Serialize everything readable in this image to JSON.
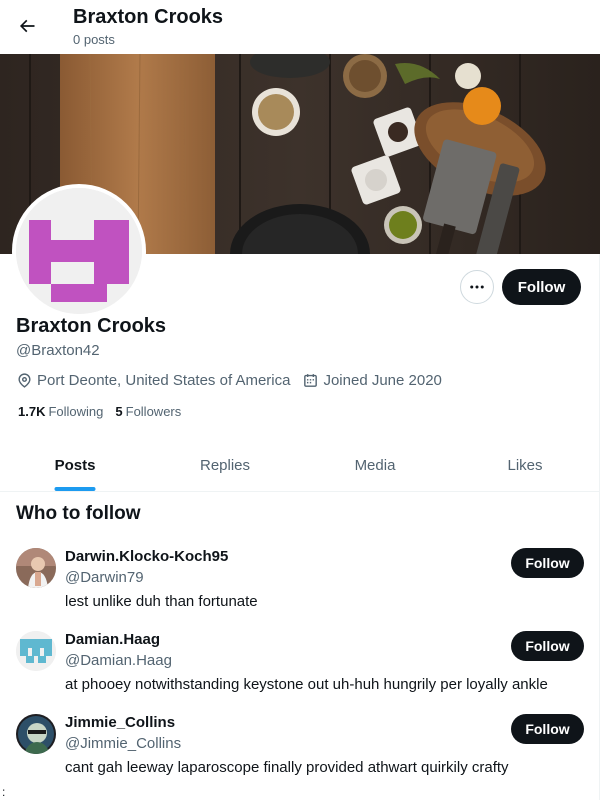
{
  "header": {
    "title": "Braxton Crooks",
    "subtitle": "0 posts"
  },
  "profile": {
    "name": "Braxton Crooks",
    "handle": "@Braxton42",
    "location": "Port Deonte, United States of America",
    "joined": "Joined June 2020",
    "following_count": "1.7K",
    "following_label": "Following",
    "followers_count": "5",
    "followers_label": "Followers",
    "follow_label": "Follow",
    "avatar_color": "#c052c0"
  },
  "tabs": [
    {
      "label": "Posts",
      "active": true
    },
    {
      "label": "Replies",
      "active": false
    },
    {
      "label": "Media",
      "active": false
    },
    {
      "label": "Likes",
      "active": false
    }
  ],
  "who_to_follow": {
    "title": "Who to follow",
    "suggestions": [
      {
        "name": "Darwin.Klocko-Koch95",
        "handle": "@Darwin79",
        "bio": "lest unlike duh than fortunate",
        "follow_label": "Follow"
      },
      {
        "name": "Damian.Haag",
        "handle": "@Damian.Haag",
        "bio": "at phooey notwithstanding keystone out uh-huh hungrily per loyally ankle",
        "follow_label": "Follow"
      },
      {
        "name": "Jimmie_Collins",
        "handle": "@Jimmie_Collins",
        "bio": "cant gah leeway laparoscope finally provided athwart quirkily crafty",
        "follow_label": "Follow"
      }
    ]
  },
  "stray_text": ":",
  "colors": {
    "accent": "#1d9bf0",
    "button_dark": "#0f1419",
    "muted": "#536471"
  }
}
